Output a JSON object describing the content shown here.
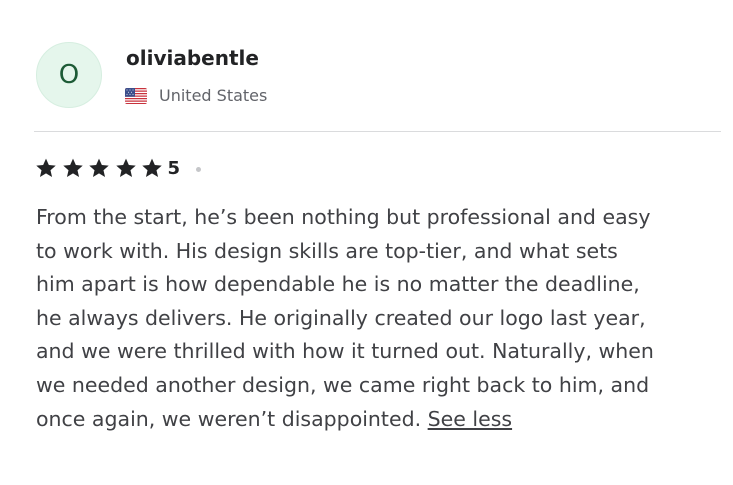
{
  "reviewer": {
    "avatar_initial": "O",
    "username": "oliviabentle",
    "country": "United States",
    "flag_icon": "us-flag-icon"
  },
  "rating": {
    "stars": 5,
    "value_label": "5",
    "star_color": "#222325"
  },
  "review": {
    "lines": [
      "From the start, he’s been nothing but professional and easy",
      "to work with. His design skills are top-tier, and what sets",
      "him apart is how dependable he is no matter the deadline,",
      "he always delivers. He originally created our logo last year,",
      "and we were thrilled with how it turned out. Naturally, when",
      "we needed another design, we came right back to him, and",
      "once again, we weren’t disappointed."
    ],
    "toggle_label": "See less"
  },
  "colors": {
    "avatar_bg": "#e5f6ec",
    "avatar_text": "#1d5b36",
    "text": "#404145",
    "muted": "#62646a",
    "divider": "#dadbdd"
  }
}
